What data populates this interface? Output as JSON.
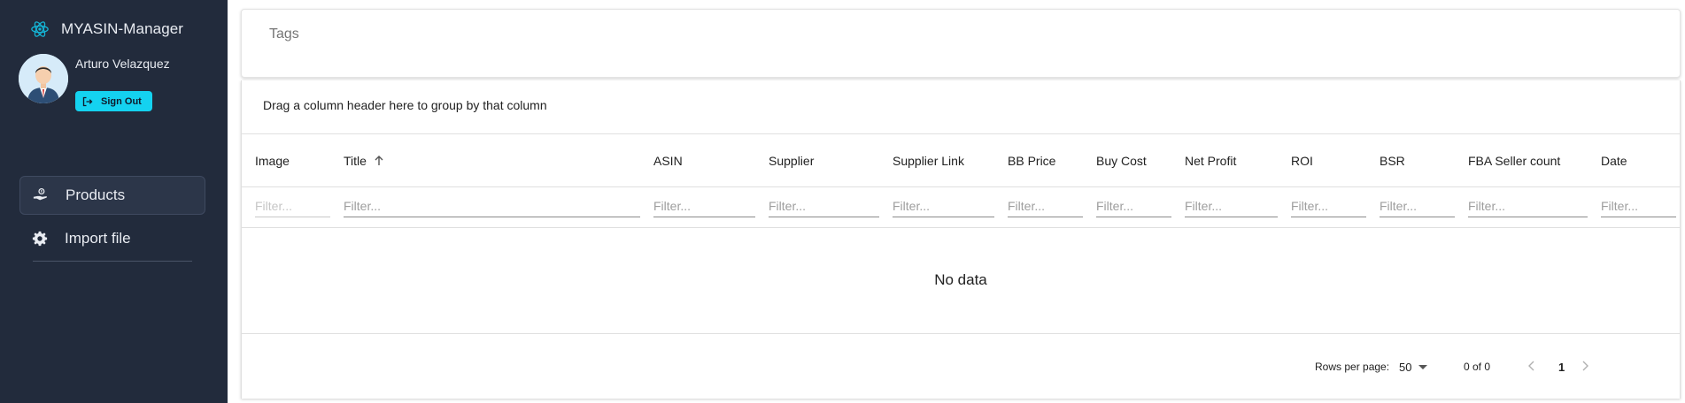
{
  "app": {
    "brand_name": "MYASIN-Manager",
    "accent_color": "#14d2f0",
    "sidebar_bg": "#222b3c"
  },
  "user": {
    "name": "Arturo Velazquez",
    "sign_out_label": "Sign Out"
  },
  "nav": {
    "items": [
      {
        "label": "Products",
        "icon": "product-hand-icon",
        "active": true
      },
      {
        "label": "Import file",
        "icon": "gear-icon",
        "active": false
      }
    ]
  },
  "tags": {
    "label": "Tags"
  },
  "grid": {
    "group_panel_text": "Drag a column header here to group by that column",
    "columns": [
      {
        "label": "Image",
        "sort": "",
        "filter_placeholder": "Filter...",
        "filter_enabled": false
      },
      {
        "label": "Title",
        "sort": "ascending",
        "filter_placeholder": "Filter...",
        "filter_enabled": true
      },
      {
        "label": "ASIN",
        "sort": "",
        "filter_placeholder": "Filter...",
        "filter_enabled": true
      },
      {
        "label": "Supplier",
        "sort": "",
        "filter_placeholder": "Filter...",
        "filter_enabled": true
      },
      {
        "label": "Supplier Link",
        "sort": "",
        "filter_placeholder": "Filter...",
        "filter_enabled": true
      },
      {
        "label": "BB Price",
        "sort": "",
        "filter_placeholder": "Filter...",
        "filter_enabled": true
      },
      {
        "label": "Buy Cost",
        "sort": "",
        "filter_placeholder": "Filter...",
        "filter_enabled": true
      },
      {
        "label": "Net Profit",
        "sort": "",
        "filter_placeholder": "Filter...",
        "filter_enabled": true
      },
      {
        "label": "ROI",
        "sort": "",
        "filter_placeholder": "Filter...",
        "filter_enabled": true
      },
      {
        "label": "BSR",
        "sort": "",
        "filter_placeholder": "Filter...",
        "filter_enabled": true
      },
      {
        "label": "FBA Seller count",
        "sort": "",
        "filter_placeholder": "Filter...",
        "filter_enabled": true
      },
      {
        "label": "Date",
        "sort": "",
        "filter_placeholder": "Filter...",
        "filter_enabled": true
      }
    ],
    "rows": [],
    "no_data_text": "No data"
  },
  "pagination": {
    "rows_per_page_label": "Rows per page:",
    "rows_per_page_value": "50",
    "page_info": "0 of 0",
    "current_page": "1"
  }
}
